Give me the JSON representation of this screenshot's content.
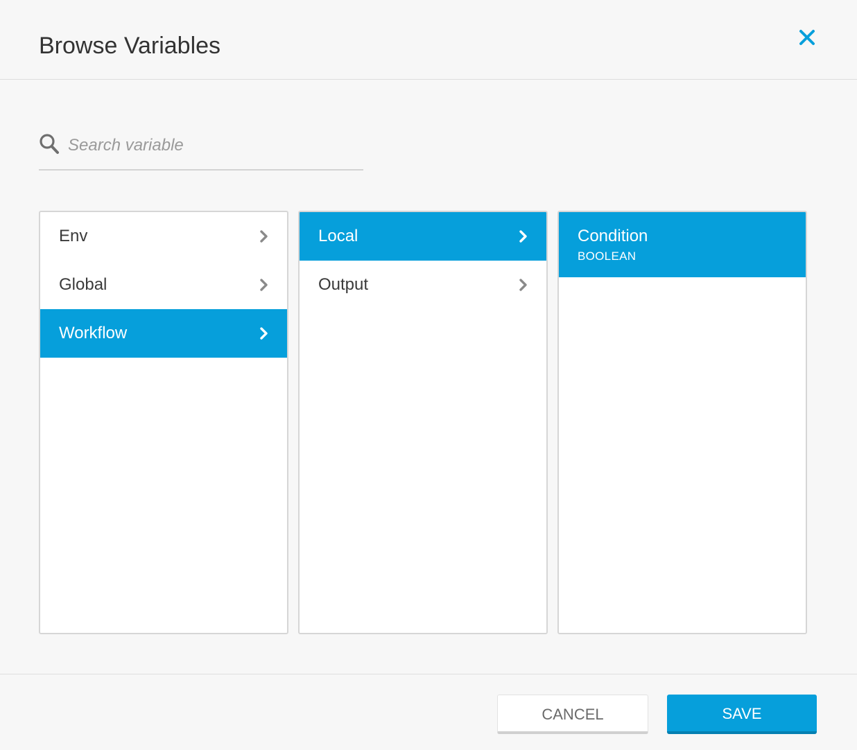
{
  "dialog": {
    "title": "Browse Variables"
  },
  "search": {
    "placeholder": "Search variable",
    "value": ""
  },
  "columns": {
    "scopes": [
      {
        "label": "Env",
        "selected": false
      },
      {
        "label": "Global",
        "selected": false
      },
      {
        "label": "Workflow",
        "selected": true
      }
    ],
    "groups": [
      {
        "label": "Local",
        "selected": true
      },
      {
        "label": "Output",
        "selected": false
      }
    ],
    "variables": [
      {
        "label": "Condition",
        "type": "BOOLEAN",
        "selected": true
      }
    ]
  },
  "footer": {
    "cancel_label": "CANCEL",
    "save_label": "SAVE"
  },
  "colors": {
    "accent": "#069fdb",
    "chevron_inactive": "#8a8a8a"
  },
  "icons": {
    "close": "close-icon",
    "search": "search-icon",
    "chevron": "chevron-right-icon"
  }
}
